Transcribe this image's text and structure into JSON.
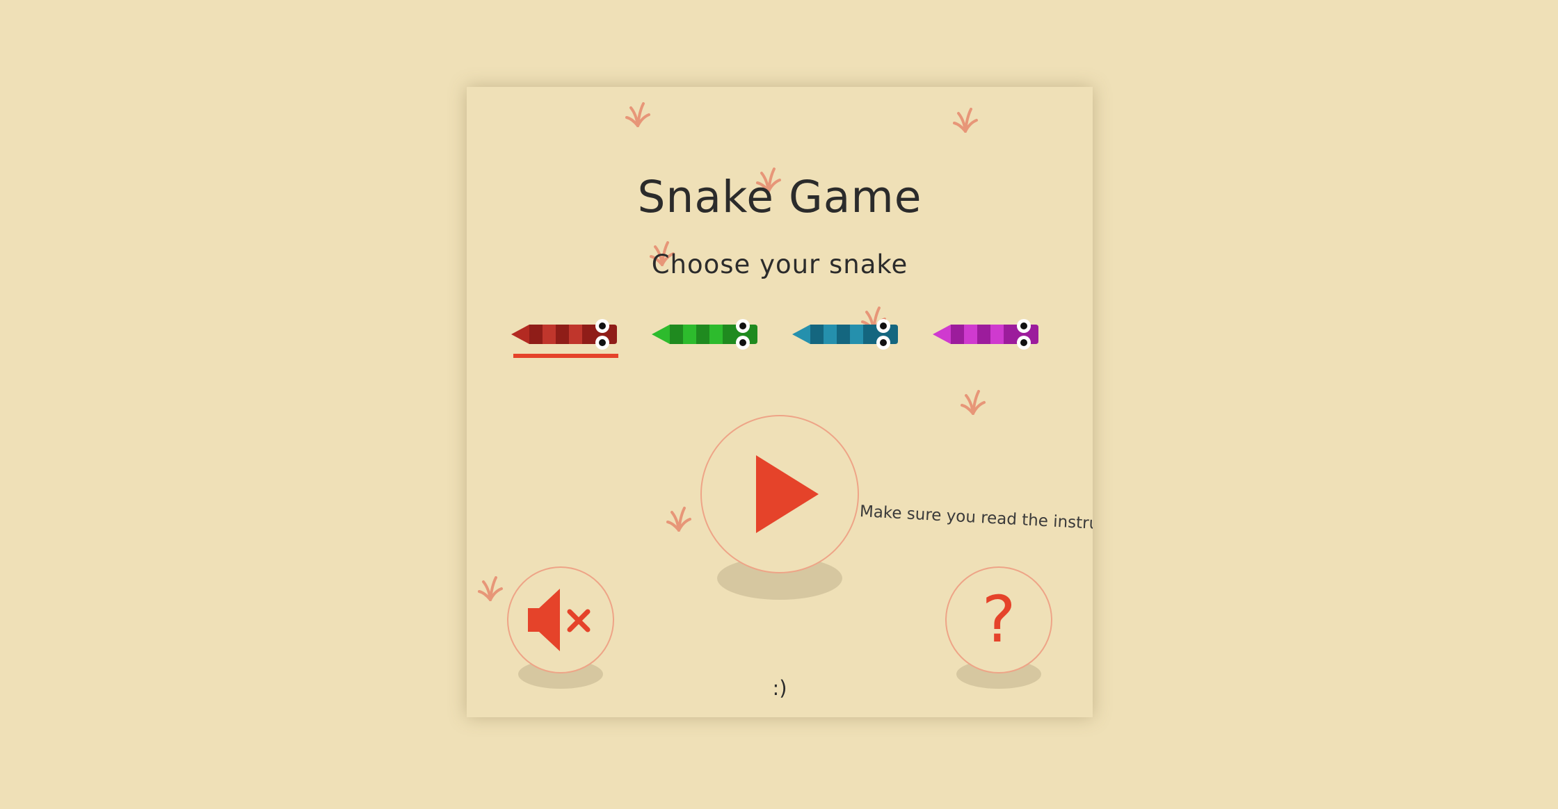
{
  "game": {
    "title": "Snake Game",
    "subtitle": "Choose your snake",
    "marquee_text": "Make sure you read the instruct",
    "footer_smiley": ":)",
    "help_label": "?"
  },
  "snakes": [
    {
      "name": "red",
      "dark": "#8f1d18",
      "light": "#c0362c",
      "selected": true
    },
    {
      "name": "green",
      "dark": "#1f8a1f",
      "light": "#2dbb2d",
      "selected": false
    },
    {
      "name": "blue",
      "dark": "#14667f",
      "light": "#2590ad",
      "selected": false
    },
    {
      "name": "purple",
      "dark": "#9c1c9c",
      "light": "#cf3acf",
      "selected": false
    }
  ],
  "icons": {
    "play": "play-icon",
    "mute": "speaker-muted-icon",
    "help": "question-mark-icon",
    "grass": "grass-tuft-icon"
  },
  "colors": {
    "accent": "#e5432a",
    "background": "#efe0b7",
    "ring": "#eea487",
    "grass": "#e79678",
    "text": "#2b2b2b"
  }
}
